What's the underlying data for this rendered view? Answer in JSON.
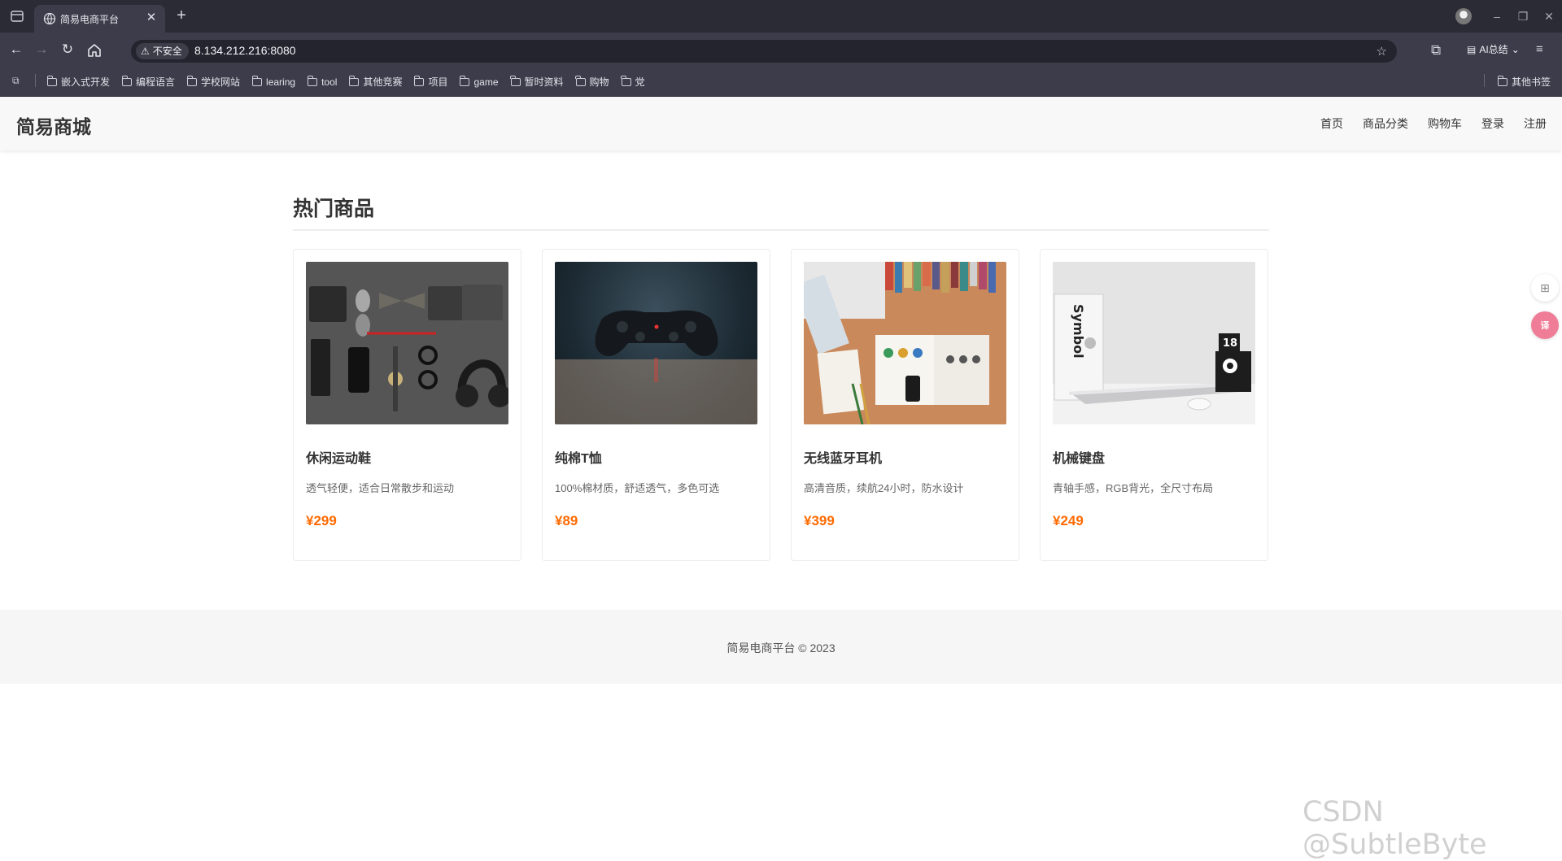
{
  "browser": {
    "tab_title": "简易电商平台",
    "new_tab": "+",
    "address": {
      "security_label": "不安全",
      "url": "8.134.212.216:8080"
    },
    "ai_summary_label": "AI总结",
    "bookmarks": [
      "嵌入式开发",
      "编程语言",
      "学校网站",
      "learing",
      "tool",
      "其他竞赛",
      "项目",
      "game",
      "暂时资料",
      "购物",
      "党"
    ],
    "other_bookmarks": "其他书签"
  },
  "site": {
    "logo": "简易商城",
    "nav": [
      "首页",
      "商品分类",
      "购物车",
      "登录",
      "注册"
    ],
    "section_title": "热门商品",
    "products": [
      {
        "name": "休闲运动鞋",
        "desc": "透气轻便，适合日常散步和运动",
        "price": "¥299",
        "image": "flatlay-accessories"
      },
      {
        "name": "纯棉T恤",
        "desc": "100%棉材质，舒适透气，多色可选",
        "price": "¥89",
        "image": "game-controller"
      },
      {
        "name": "无线蓝牙耳机",
        "desc": "高清音质，续航24小时，防水设计",
        "price": "¥399",
        "image": "desk-workspace"
      },
      {
        "name": "机械键盘",
        "desc": "青轴手感，RGB背光，全尺寸布局",
        "price": "¥249",
        "image": "laptop-desk"
      }
    ],
    "footer": "简易电商平台 © 2023"
  },
  "watermark": "CSDN @SubtleByte",
  "colors": {
    "price": "#ff6a00",
    "chrome_dark": "#2b2b36",
    "chrome": "#3c3c4a",
    "header_bg": "#f8f8f8"
  }
}
